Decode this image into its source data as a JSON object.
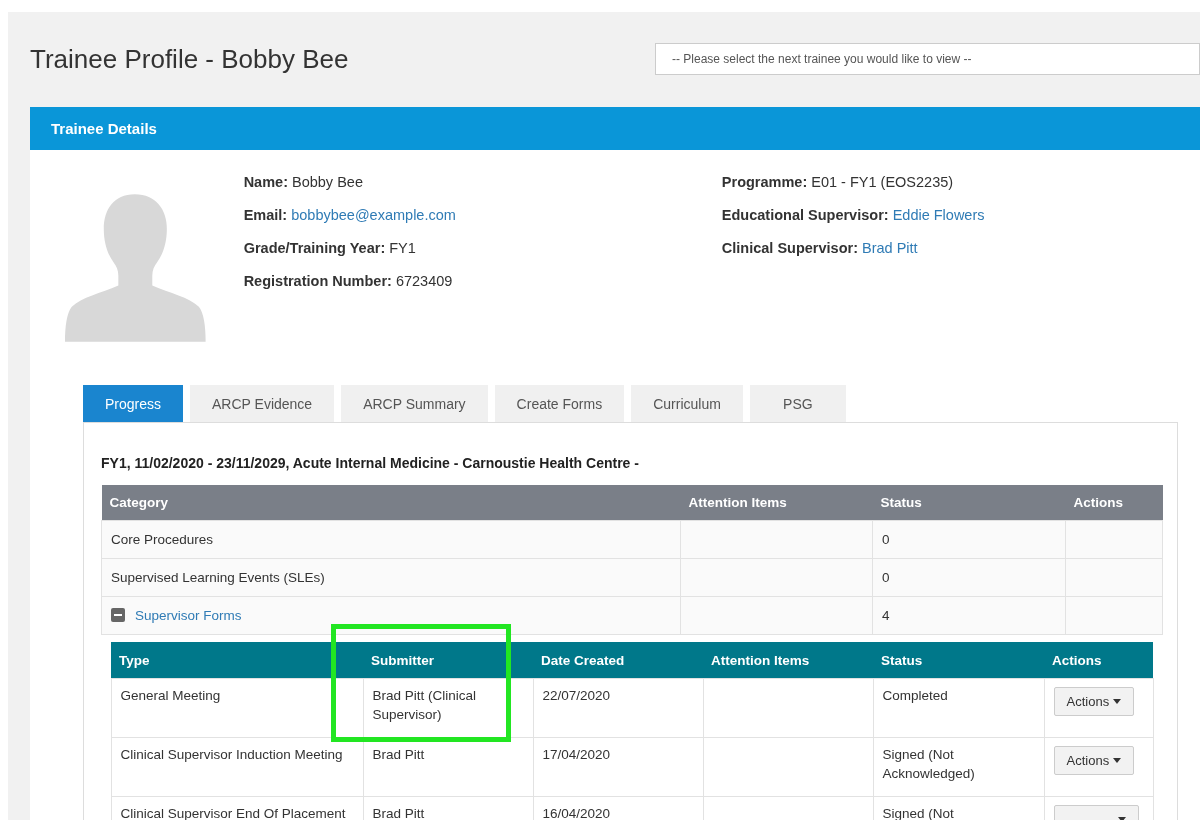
{
  "page_title": "Trainee Profile - Bobby Bee",
  "trainee_select": {
    "placeholder": "-- Please select the next trainee you would like to view --"
  },
  "panel_title": "Trainee Details",
  "details_left": [
    {
      "label": "Name:",
      "value": "Bobby Bee",
      "kind": "text"
    },
    {
      "label": "Email:",
      "value": "bobbybee@example.com",
      "kind": "link"
    },
    {
      "label": "Grade/Training Year:",
      "value": "FY1",
      "kind": "text"
    },
    {
      "label": "Registration Number:",
      "value": "6723409",
      "kind": "text"
    }
  ],
  "details_right": [
    {
      "label": "Programme:",
      "value": "E01 - FY1 (EOS2235)",
      "kind": "text"
    },
    {
      "label": "Educational Supervisor:",
      "value": "Eddie Flowers",
      "kind": "link"
    },
    {
      "label": "Clinical Supervisor:",
      "value": "Brad Pitt",
      "kind": "link"
    }
  ],
  "tabs": [
    {
      "label": "Progress",
      "selected": true
    },
    {
      "label": "ARCP Evidence",
      "selected": false
    },
    {
      "label": "ARCP Summary",
      "selected": false
    },
    {
      "label": "Create Forms",
      "selected": false
    },
    {
      "label": "Curriculum",
      "selected": false
    },
    {
      "label": "PSG",
      "selected": false
    }
  ],
  "placement": "FY1, 11/02/2020 - 23/11/2029, Acute Internal Medicine - Carnoustie Health Centre -",
  "progress_table": {
    "columns": [
      "Category",
      "Attention Items",
      "Status",
      "Actions"
    ],
    "rows": [
      {
        "category": "Core Procedures",
        "status": "0",
        "kind": "plain"
      },
      {
        "category": "Supervised Learning Events (SLEs)",
        "status": "0",
        "kind": "plain"
      },
      {
        "category": "Supervisor Forms",
        "status": "4",
        "kind": "expandable",
        "expanded": true
      }
    ]
  },
  "forms_table": {
    "columns": [
      {
        "label": "Type",
        "highlighted": false
      },
      {
        "label": "Submitter",
        "highlighted": true
      },
      {
        "label": "Date Created",
        "highlighted": false
      },
      {
        "label": "Attention Items",
        "highlighted": false
      },
      {
        "label": "Status",
        "highlighted": false
      },
      {
        "label": "Actions",
        "highlighted": false
      }
    ],
    "rows": [
      {
        "type": "General Meeting",
        "submitter": "Brad Pitt (Clinical Supervisor)",
        "date_created": "22/07/2020",
        "status": "Completed",
        "action": "Actions"
      },
      {
        "type": "Clinical Supervisor Induction Meeting",
        "submitter": "Brad Pitt",
        "date_created": "17/04/2020",
        "status": "Signed (Not Acknowledged)",
        "action": "Actions"
      },
      {
        "type": "Clinical Supervisor End Of Placement",
        "submitter": "Brad Pitt",
        "date_created": "16/04/2020",
        "status": "Signed (Not"
      }
    ]
  }
}
